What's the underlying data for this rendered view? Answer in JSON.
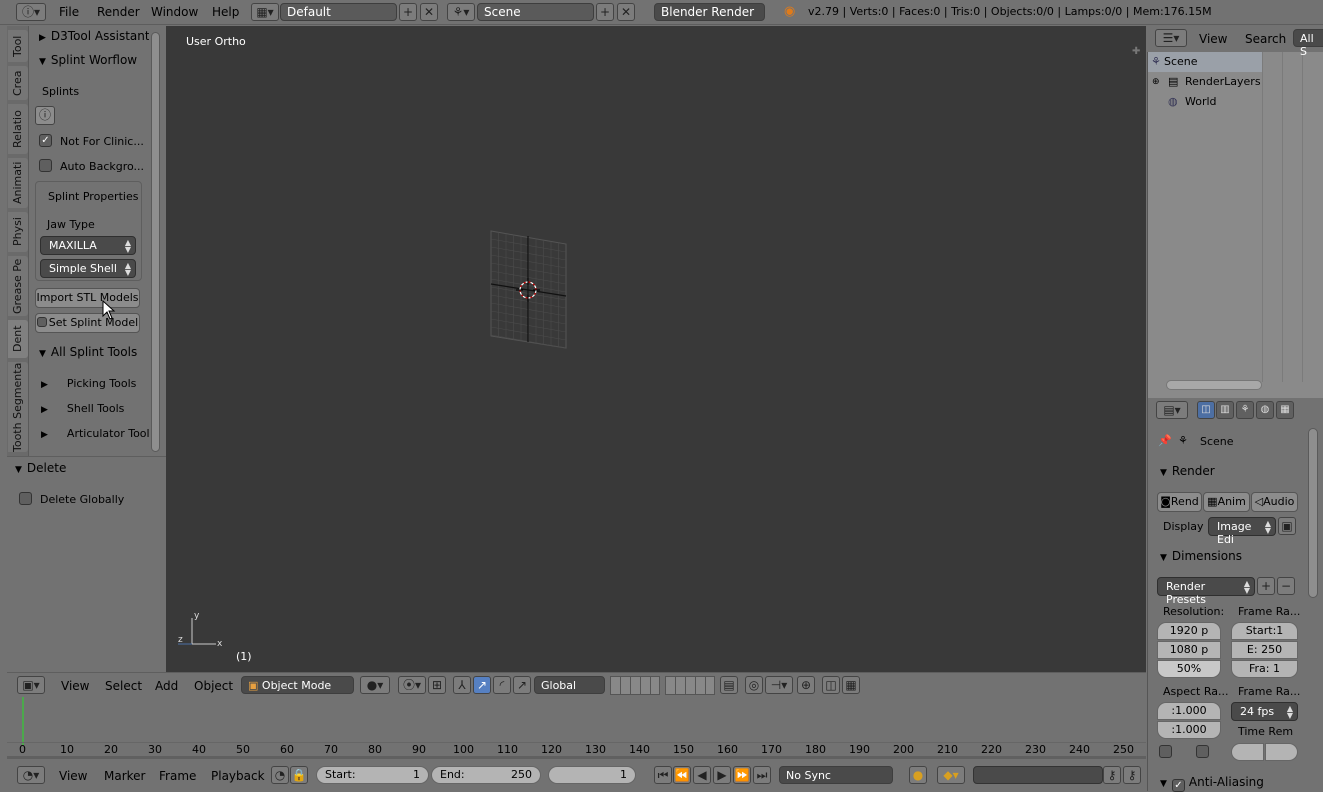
{
  "topbar": {
    "menus": [
      "File",
      "Render",
      "Window",
      "Help"
    ],
    "screen_layout": "Default",
    "scene": "Scene",
    "render_engine": "Blender Render",
    "stats": "v2.79 | Verts:0 | Faces:0 | Tris:0 | Objects:0/0 | Lamps:0/0 | Mem:176.15M"
  },
  "vertical_tabs": [
    "Tool",
    "Crea",
    "Relatio",
    "Animati",
    "Physi",
    "Grease Pe",
    "Dent",
    "Tooth Segmenta"
  ],
  "tool_panel": {
    "d3tool_header": "D3Tool Assistant",
    "splint_header": "Splint Worflow",
    "splints_label": "Splints",
    "not_for_clinical": "Not For Clinic...",
    "auto_background": "Auto Backgro...",
    "splint_properties": "Splint Properties",
    "jaw_type_label": "Jaw Type",
    "jaw_type_value": "MAXILLA",
    "shell_value": "Simple Shell",
    "import_stl": "Import STL Models",
    "set_splint": "Set Splint Model",
    "all_splint_tools": "All Splint Tools",
    "subpanels": [
      "Picking Tools",
      "Shell Tools",
      "Articulator Tools"
    ],
    "delete_header": "Delete",
    "delete_globally": "Delete Globally"
  },
  "viewport": {
    "view_label": "User Ortho",
    "frame_label": "(1)"
  },
  "view3d_header": {
    "menus": [
      "View",
      "Select",
      "Add",
      "Object"
    ],
    "mode": "Object Mode",
    "orientation": "Global"
  },
  "timeline": {
    "ticks": [
      "0",
      "10",
      "20",
      "30",
      "40",
      "50",
      "60",
      "70",
      "80",
      "90",
      "100",
      "110",
      "120",
      "130",
      "140",
      "150",
      "160",
      "170",
      "180",
      "190",
      "200",
      "210",
      "220",
      "230",
      "240",
      "250"
    ]
  },
  "timeline_header": {
    "menus": [
      "View",
      "Marker",
      "Frame",
      "Playback"
    ],
    "start_label": "Start:",
    "start_value": "1",
    "end_label": "End:",
    "end_value": "250",
    "current_frame": "1",
    "sync": "No Sync"
  },
  "outliner": {
    "menus": [
      "View",
      "Search"
    ],
    "filter": "All S",
    "items": [
      "Scene",
      "RenderLayers",
      "World"
    ]
  },
  "properties": {
    "scene_label": "Scene",
    "render_header": "Render",
    "render_buttons": [
      "Rend",
      "Anim",
      "Audio"
    ],
    "display_label": "Display",
    "display_value": "Image Edi",
    "dimensions_header": "Dimensions",
    "render_presets": "Render Presets",
    "resolution_label": "Resolution:",
    "frame_range_label": "Frame Ra...",
    "res_x": "1920 p",
    "res_y": "1080 p",
    "res_pct": "50%",
    "start_frame": "Start:1",
    "end_frame": "E: 250",
    "frame_step": "Fra:  1",
    "aspect_label": "Aspect Ra...",
    "frame_rate_label": "Frame Ra...",
    "aspect_x": ":1.000",
    "aspect_y": ":1.000",
    "fps": "24 fps",
    "time_rem": "Time Rem",
    "anti_aliasing": "Anti-Aliasing"
  }
}
